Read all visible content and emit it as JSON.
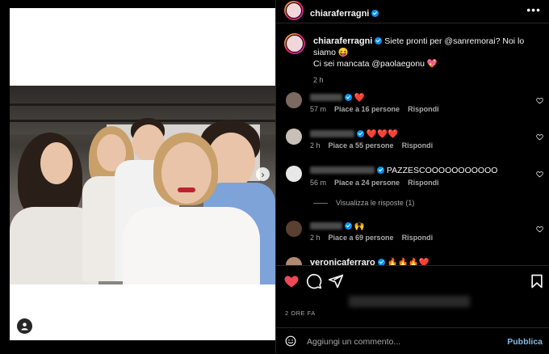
{
  "post": {
    "author": "chiaraferragni",
    "caption_author": "chiaraferragni",
    "caption_line1": "Siete pronti per @sanremorai? Noi lo siamo 😝",
    "caption_line2": "Ci sei mancata @paolaegonu 💖",
    "caption_time": "2 h",
    "timestamp": "2 ORE FA"
  },
  "comments": [
    {
      "text": "❤️",
      "time": "57 m",
      "likes": "Piace a 16 persone",
      "reply": "Rispondi"
    },
    {
      "text": "❤️❤️❤️",
      "time": "2 h",
      "likes": "Piace a 55 persone",
      "reply": "Rispondi"
    },
    {
      "text": "PAZZESCOOOOOOOOOOO",
      "time": "56 m",
      "likes": "Piace a 24 persone",
      "reply": "Rispondi"
    },
    {
      "text": "🙌",
      "time": "2 h",
      "likes": "Piace a 69 persone",
      "reply": "Rispondi"
    },
    {
      "author": "veronicaferraro",
      "text": "🔥🔥🔥❤️"
    }
  ],
  "view_replies": "Visualizza le risposte (1)",
  "add_comment": {
    "placeholder": "Aggiungi un commento...",
    "publish": "Pubblica"
  },
  "icons": {
    "more": "more-horizontal-icon",
    "like": "heart-filled-icon",
    "comment": "comment-icon",
    "share": "send-icon",
    "save": "bookmark-icon",
    "emoji": "emoji-icon",
    "user_tag": "user-tag-icon",
    "next": "chevron-right-icon"
  },
  "colors": {
    "like": "#ed4956",
    "verified": "#0095f6",
    "publish": "#85b7e6",
    "background": "#000000"
  }
}
